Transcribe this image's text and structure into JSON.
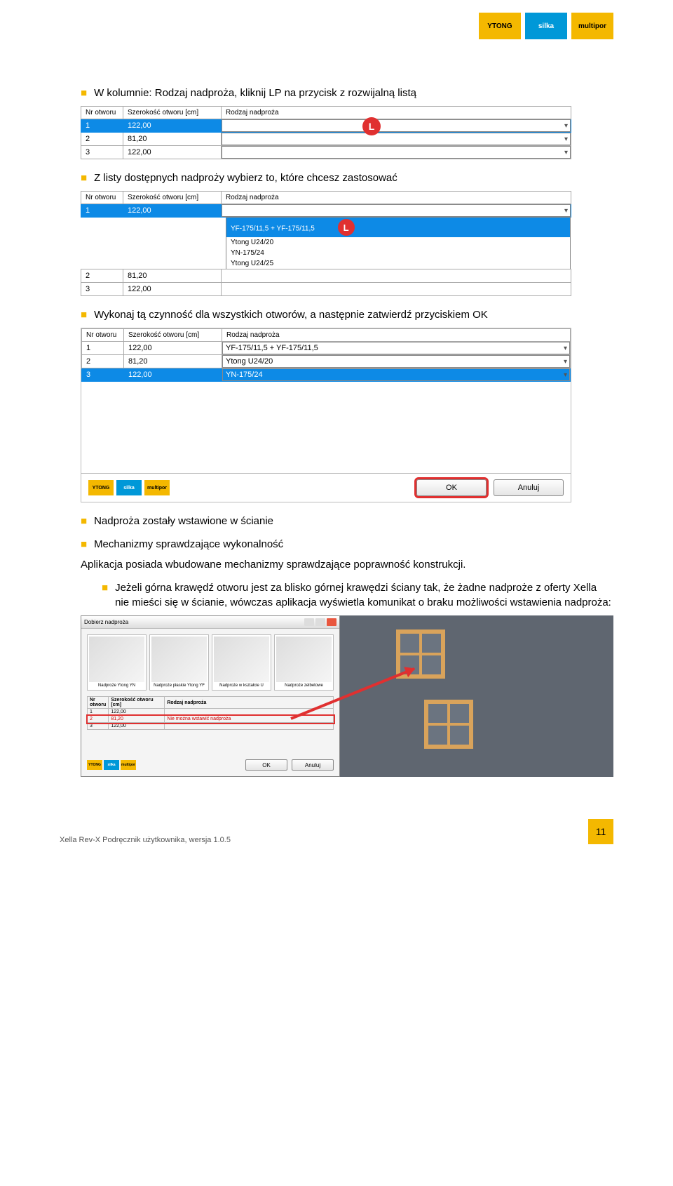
{
  "brands": {
    "ytong": "YTONG",
    "silka": "silka",
    "multipor": "multipor"
  },
  "bullets": {
    "b1": "W kolumnie: Rodzaj nadproża, kliknij LP na przycisk z rozwijalną listą",
    "b2": "Z listy dostępnych nadproży wybierz to, które chcesz zastosować",
    "b3": "Wykonaj tą czynność dla wszystkich otworów, a następnie zatwierdź przyciskiem OK",
    "b4": "Nadproża zostały wstawione w ścianie",
    "b5": "Mechanizmy sprawdzające wykonalność",
    "b6": "Jeżeli górna krawędź otworu jest za blisko górnej krawędzi ściany tak, że żadne nadproże z oferty Xella nie mieści się w ścianie, wówczas aplikacja wyświetla komunikat o braku możliwości wstawienia nadproża:"
  },
  "para1": "Aplikacja posiada wbudowane mechanizmy sprawdzające poprawność konstrukcji.",
  "table_headers": {
    "c1": "Nr otworu",
    "c2": "Szerokość otworu [cm]",
    "c3": "Rodzaj nadproża"
  },
  "t1": {
    "r1": {
      "n": "1",
      "w": "122,00"
    },
    "r2": {
      "n": "2",
      "w": "81,20"
    },
    "r3": {
      "n": "3",
      "w": "122,00"
    }
  },
  "dropdown_opts": {
    "o1": "YF-175/11,5 + YF-175/11,5",
    "o2": "Ytong U24/20",
    "o3": "YN-175/24",
    "o4": "Ytong U24/25"
  },
  "t3": {
    "r1": {
      "n": "1",
      "w": "122,00",
      "v": "YF-175/11,5 + YF-175/11,5"
    },
    "r2": {
      "n": "2",
      "w": "81,20",
      "v": "Ytong U24/20"
    },
    "r3": {
      "n": "3",
      "w": "122,00",
      "v": "YN-175/24"
    }
  },
  "buttons": {
    "ok": "OK",
    "cancel": "Anuluj"
  },
  "marker": "L",
  "dlg2": {
    "title": "Dobierz nadproża",
    "types": {
      "t1": "Nadproże Ytong YN",
      "t2": "Nadproże płaskie Ytong YF",
      "t3": "Nadproże w kształcie U",
      "t4": "Nadproże zelbetowe"
    },
    "rows": {
      "r1": {
        "n": "1",
        "w": "122,00",
        "v": ""
      },
      "r2": {
        "n": "2",
        "w": "81,20",
        "v": "Nie można wstawić nadproża"
      },
      "r3": {
        "n": "3",
        "w": "122,00",
        "v": ""
      }
    }
  },
  "footer": {
    "text": "Xella Rev-X Podręcznik użytkownika, wersja 1.0.5",
    "page": "11"
  }
}
